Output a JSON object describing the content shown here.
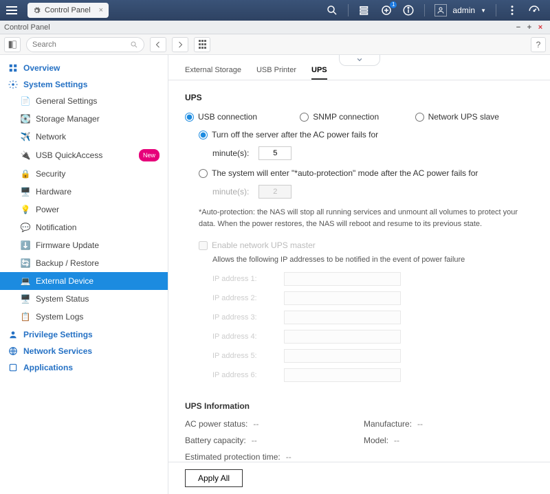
{
  "header": {
    "app_tab_label": "Control Panel",
    "user_name": "admin",
    "notif_badge": "1"
  },
  "window": {
    "title": "Control Panel"
  },
  "toolbar": {
    "search_placeholder": "Search"
  },
  "sidebar": {
    "overview": "Overview",
    "system_settings": "System Settings",
    "items": [
      {
        "label": "General Settings"
      },
      {
        "label": "Storage Manager"
      },
      {
        "label": "Network"
      },
      {
        "label": "USB QuickAccess",
        "badge": "New"
      },
      {
        "label": "Security"
      },
      {
        "label": "Hardware"
      },
      {
        "label": "Power"
      },
      {
        "label": "Notification"
      },
      {
        "label": "Firmware Update"
      },
      {
        "label": "Backup / Restore"
      },
      {
        "label": "External Device"
      },
      {
        "label": "System Status"
      },
      {
        "label": "System Logs"
      }
    ],
    "privilege": "Privilege Settings",
    "network_services": "Network Services",
    "applications": "Applications"
  },
  "tabs": {
    "external_storage": "External Storage",
    "usb_printer": "USB Printer",
    "ups": "UPS"
  },
  "ups": {
    "heading": "UPS",
    "usb_connection": "USB connection",
    "snmp_connection": "SNMP connection",
    "network_slave": "Network UPS slave",
    "turnoff_label": "Turn off the server after the AC power fails for",
    "minutes_label": "minute(s):",
    "minutes_value": "5",
    "autoprotect_label": "The system will enter \"*auto-protection\" mode after the AC power fails for",
    "autoprotect_minutes": "2",
    "note": "*Auto-protection: the NAS will stop all running services and unmount all volumes to protect your data. When the power restores, the NAS will reboot and resume to its previous state.",
    "enable_master": "Enable network UPS master",
    "allow_ip_desc": "Allows the following IP addresses to be notified in the event of power failure",
    "ip_labels": [
      "IP address 1:",
      "IP address 2:",
      "IP address 3:",
      "IP address 4:",
      "IP address 5:",
      "IP address 6:"
    ]
  },
  "info": {
    "heading": "UPS Information",
    "ac_power_label": "AC power status:",
    "ac_power_val": "--",
    "manufacture_label": "Manufacture:",
    "manufacture_val": "--",
    "battery_label": "Battery capacity:",
    "battery_val": "--",
    "model_label": "Model:",
    "model_val": "--",
    "est_label": "Estimated protection time:",
    "est_val": "--"
  },
  "footer": {
    "apply": "Apply All"
  }
}
